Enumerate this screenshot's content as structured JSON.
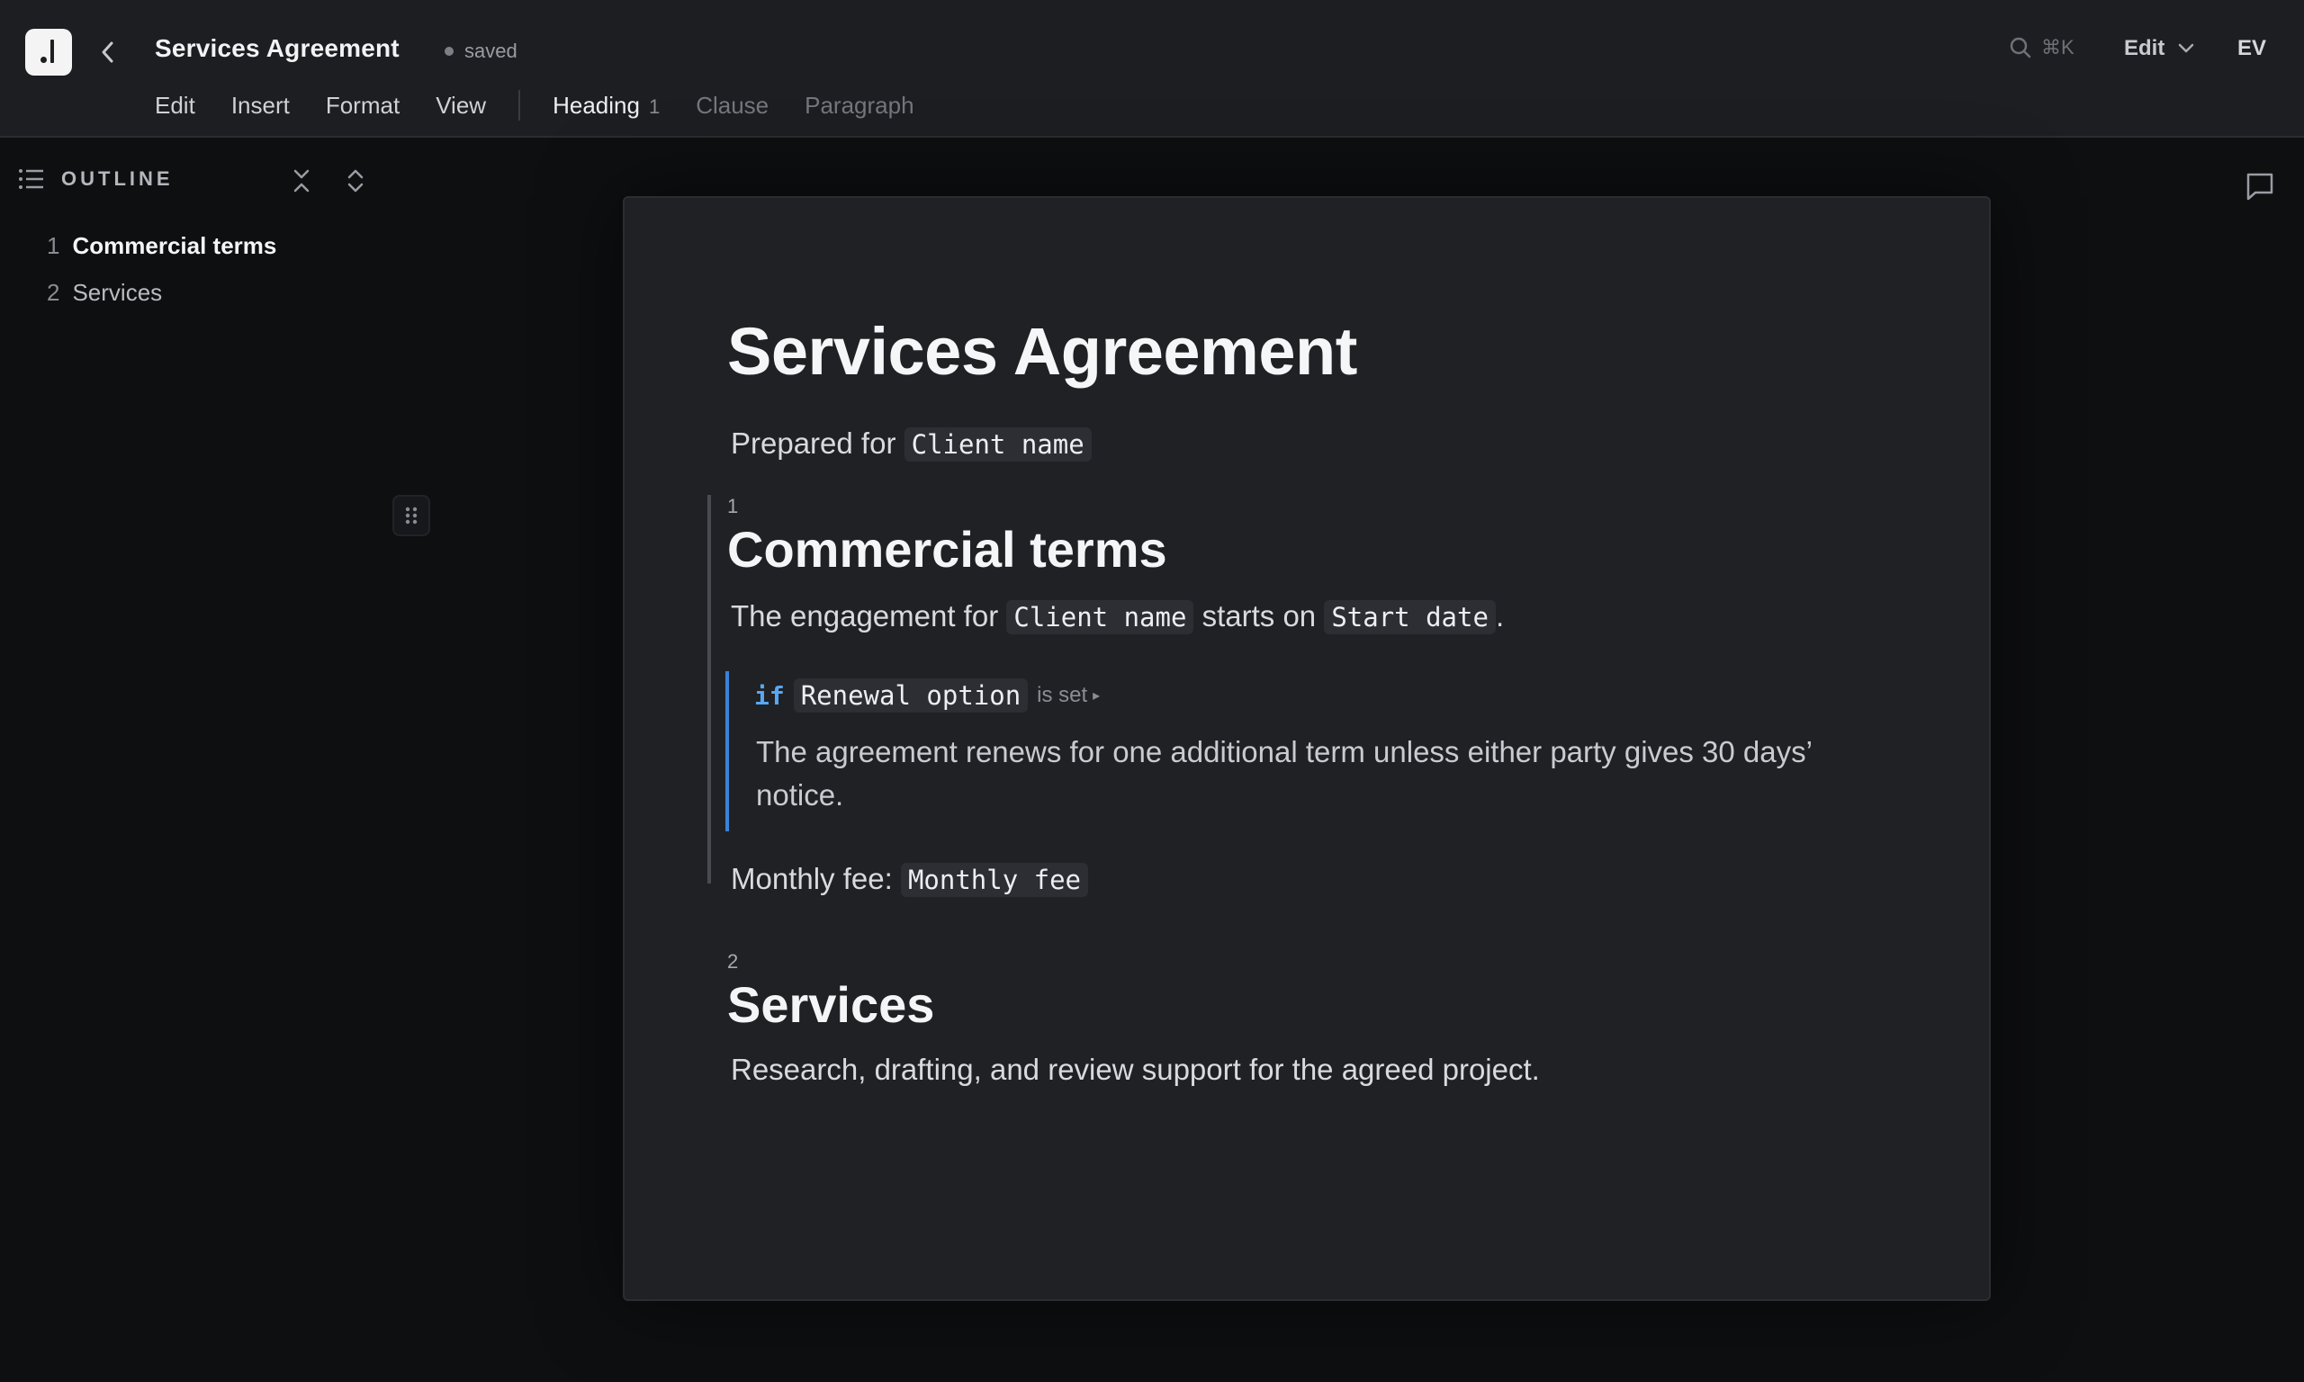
{
  "app": {
    "doc_title": "Services Agreement",
    "save_status": "saved",
    "search_shortcut": "⌘K",
    "mode_label": "Edit",
    "user_initials": "EV"
  },
  "menu": {
    "items": [
      "Edit",
      "Insert",
      "Format",
      "View"
    ]
  },
  "block_types": {
    "heading_label": "Heading",
    "heading_level": "1",
    "clause_label": "Clause",
    "paragraph_label": "Paragraph"
  },
  "outline": {
    "title": "OUTLINE",
    "items": [
      {
        "num": "1",
        "label": "Commercial terms",
        "active": true
      },
      {
        "num": "2",
        "label": "Services",
        "active": false
      }
    ]
  },
  "document": {
    "title": "Services Agreement",
    "prepared_prefix": "Prepared for",
    "prepared_var": "Client name",
    "sections": [
      {
        "num": "1",
        "heading": "Commercial terms",
        "p1_prefix": "The engagement for",
        "p1_var1": "Client name",
        "p1_mid": "starts on",
        "p1_var2": "Start date",
        "p1_suffix": ".",
        "condition": {
          "keyword": "if",
          "variable": "Renewal option",
          "operator": "is set",
          "text": "The agreement renews for one additional term unless either party gives 30 days’ notice."
        },
        "fee_prefix": "Monthly fee:",
        "fee_var": "Monthly fee"
      },
      {
        "num": "2",
        "heading": "Services",
        "text": "Research, drafting, and review support for the agreed project."
      }
    ]
  },
  "colors": {
    "condition_accent": "#3b82d6",
    "keyword": "#56a8f5",
    "background": "#0e0f11",
    "page": "#202124"
  }
}
